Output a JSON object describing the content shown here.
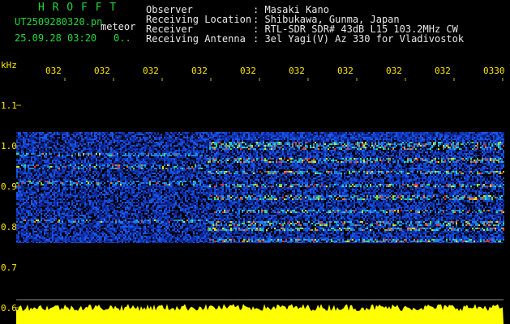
{
  "header": {
    "brand": "H R O F F T",
    "filename": "UT2509280320.pn",
    "mode": "meteor",
    "datetime": "25.09.28 03:20",
    "count": "0..",
    "info_labels": [
      "Observer",
      "Receiving Location",
      "Receiver",
      "Receiving Antenna"
    ],
    "info_values": [
      ": Masaki Kano",
      ": Shibukawa, Gunma, Japan",
      ": RTL-SDR SDR# 43dB L15 103.2MHz CW",
      ": 3el Yagi(V) Az 330 for Vladivostok"
    ]
  },
  "axes": {
    "y_unit": "kHz",
    "y_ticks": [
      "1.1",
      "1.0",
      "0.9",
      "0.8",
      "0.7",
      "0.6"
    ],
    "x_ticks": [
      "032",
      "032",
      "032",
      "032",
      "032",
      "032",
      "032",
      "032",
      "032",
      "0330"
    ]
  },
  "colors": {
    "label": "#ffe600",
    "brand": "#22d73a",
    "text": "#e8e8e8",
    "noise_low": "#0b2a9a",
    "signal_high": "#ff2a2a",
    "amplitude_fill": "#ffff00"
  }
}
